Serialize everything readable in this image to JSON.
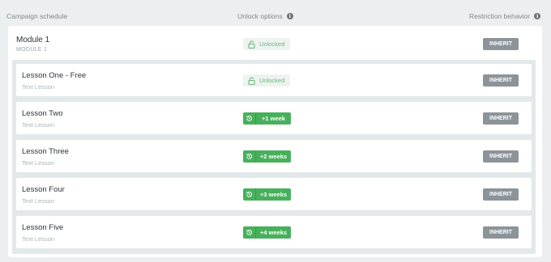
{
  "header": {
    "campaign_schedule": "Campaign schedule",
    "unlock_options": "Unlock options",
    "restriction_behavior": "Restriction behavior"
  },
  "module": {
    "title": "Module 1",
    "subtitle": "MODULE 1",
    "unlock_label": "Unlocked",
    "restriction_label": "INHERIT"
  },
  "lessons": [
    {
      "title": "Lesson One - Free",
      "type": "Text Lesson",
      "unlock": "Unlocked",
      "restriction": "INHERIT"
    },
    {
      "title": "Lesson Two",
      "type": "Text Lesson",
      "unlock": "+1 week",
      "restriction": "INHERIT"
    },
    {
      "title": "Lesson Three",
      "type": "Text Lesson",
      "unlock": "+2 weeks",
      "restriction": "INHERIT"
    },
    {
      "title": "Lesson Four",
      "type": "Text Lesson",
      "unlock": "+3 weeks",
      "restriction": "INHERIT"
    },
    {
      "title": "Lesson Five",
      "type": "Text Lesson",
      "unlock": "+4 weeks",
      "restriction": "INHERIT"
    }
  ],
  "colors": {
    "background": "#eceff0",
    "unlocked_text": "#6cb67f",
    "weeks_green": "#47b05b",
    "inherit_gray": "#8c949a"
  },
  "icons": {
    "info": "info-icon",
    "lock": "unlock-icon",
    "history": "history-icon"
  }
}
